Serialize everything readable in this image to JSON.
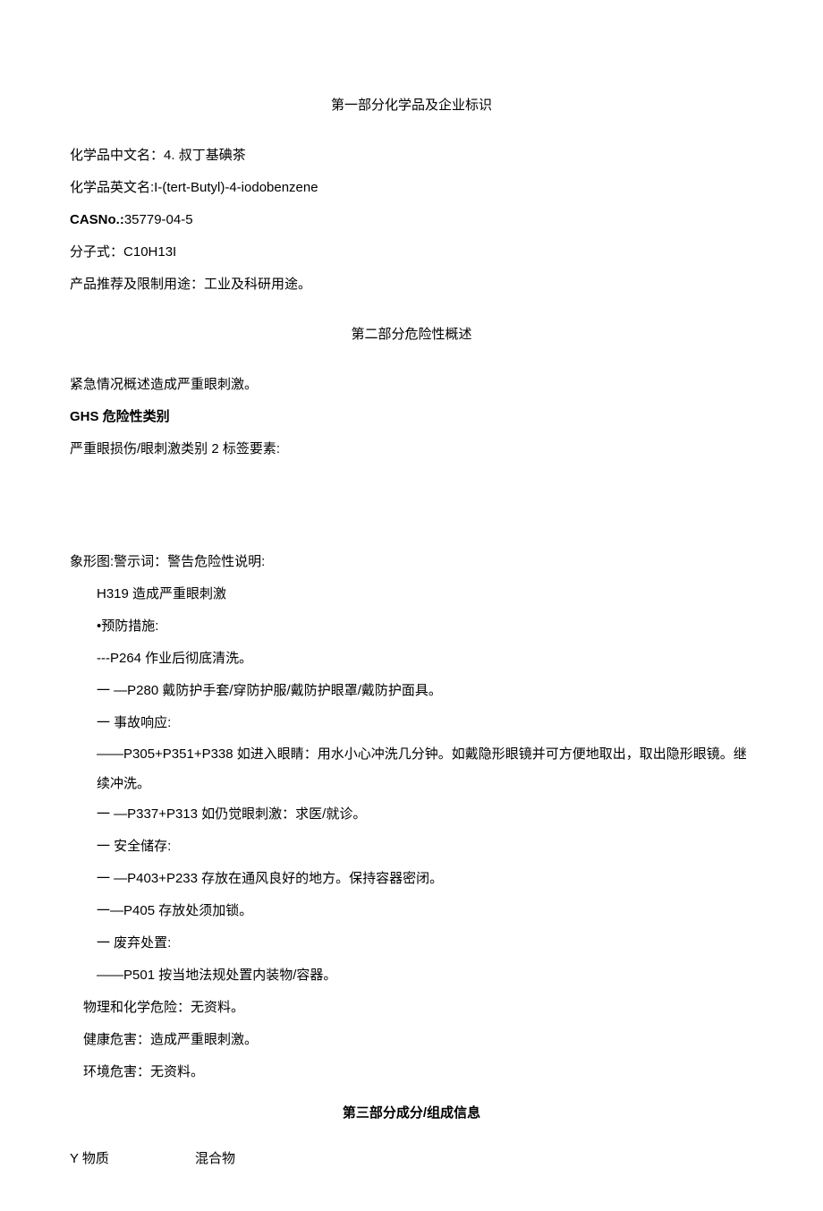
{
  "section1": {
    "title": "第一部分化学品及企业标识",
    "name_cn_label": "化学品中文名：",
    "name_cn_value": "4. 叔丁基碘茶",
    "name_en_label": "化学品英文名:",
    "name_en_value": "I-(tert-Butyl)-4-iodobenzene",
    "cas_label": "CASNo.:",
    "cas_value": "35779-04-5",
    "formula_label": "分子式：",
    "formula_value": "C10H13I",
    "use_label": "产品推荐及限制用途：",
    "use_value": "工业及科研用途。"
  },
  "section2": {
    "title": "第二部分危险性概述",
    "emergency": "紧急情况概述造成严重眼刺激。",
    "ghs_title": "GHS 危险性类别",
    "ghs_line": "严重眼损伤/眼刺激类别 2 标签要素:",
    "pictogram": "象形图:警示词：警告危险性说明:",
    "h319": "H319 造成严重眼刺激",
    "prevention_title": "•预防措施:",
    "p264": "---P264 作业后彻底清洗。",
    "p280": "一   —P280 戴防护手套/穿防护服/戴防护眼罩/戴防护面具。",
    "accident_title": "一  事故响应:",
    "p305": "——P305+P351+P338 如进入眼睛：用水小心冲洗几分钟。如戴隐形眼镜并可方便地取出，取出隐形眼镜。继续冲洗。",
    "p337": "一   —P337+P313 如仍觉眼刺激：求医/就诊。",
    "storage_title": "一  安全储存:",
    "p403": "一   —P403+P233 存放在通风良好的地方。保持容器密闭。",
    "p405": "一—P405 存放处须加锁。",
    "disposal_title": "一  废弃处置:",
    "p501": "——P501 按当地法规处置内装物/容器。",
    "phys_chem": "物理和化学危险：无资料。",
    "health": "健康危害：造成严重眼刺激。",
    "env": "环境危害：无资料。"
  },
  "section3": {
    "title": "第三部分成分/组成信息",
    "substance": "Y 物质",
    "mixture": "混合物"
  }
}
